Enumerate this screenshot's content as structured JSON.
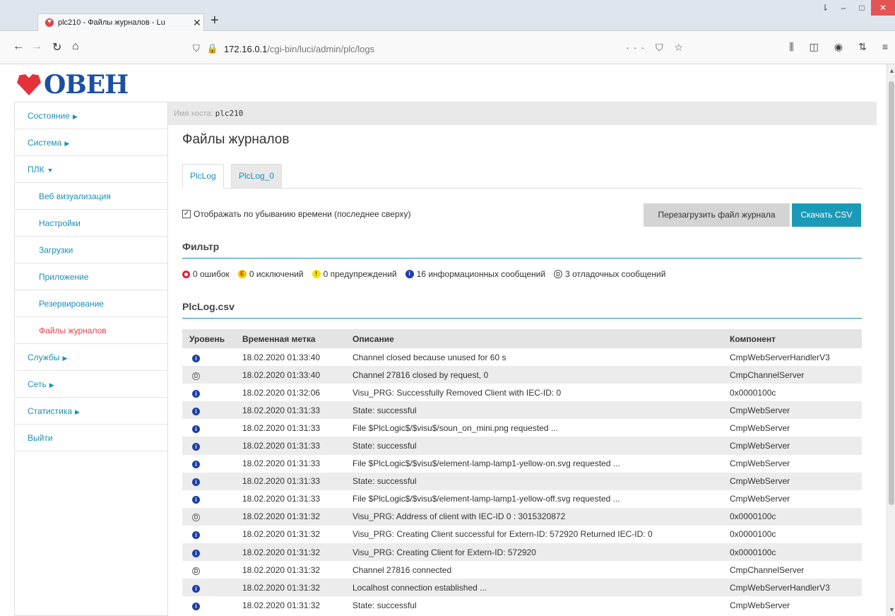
{
  "browser": {
    "tab_title": "plc210 - Файлы журналов - Lu",
    "new_tab": "+",
    "url_host": "172.16.0.1",
    "url_path": "/cgi-bin/luci/admin/plc/logs"
  },
  "brand": {
    "logo_text": "ОВЕН"
  },
  "sidebar": {
    "items": [
      {
        "label": "Состояние",
        "caret": "▶"
      },
      {
        "label": "Система",
        "caret": "▶"
      },
      {
        "label": "ПЛК",
        "caret": "▼"
      },
      {
        "label": "Веб визуализация"
      },
      {
        "label": "Настройки"
      },
      {
        "label": "Загрузки"
      },
      {
        "label": "Приложение"
      },
      {
        "label": "Резервирование"
      },
      {
        "label": "Файлы журналов"
      },
      {
        "label": "Службы",
        "caret": "▶"
      },
      {
        "label": "Сеть",
        "caret": "▶"
      },
      {
        "label": "Статистика",
        "caret": "▶"
      },
      {
        "label": "Выйти"
      }
    ]
  },
  "hostbar": {
    "label": "Имя хоста:",
    "value": "plc210"
  },
  "main": {
    "title": "Файлы журналов",
    "tabs": [
      "PlcLog",
      "PlcLog_0"
    ],
    "checkbox_label": "Отображать по убыванию времени (последнее сверху)",
    "reload_button": "Перезагрузить файл журнала",
    "csv_button": "Скачать CSV",
    "filter_heading": "Фильтр",
    "filters": {
      "errors": "0 ошибок",
      "exceptions": "0 исключений",
      "warnings": "0 предупреждений",
      "info": "16 информационных сообщений",
      "debug": "3 отладочных сообщений"
    },
    "csv_heading": "PlcLog.csv"
  },
  "table": {
    "headers": [
      "Уровень",
      "Временная метка",
      "Описание",
      "Компонент"
    ],
    "rows": [
      {
        "level": "info",
        "time": "18.02.2020 01:33:40",
        "desc": "Channel closed because unused for 60 s",
        "comp": "CmpWebServerHandlerV3"
      },
      {
        "level": "debug",
        "time": "18.02.2020 01:33:40",
        "desc": "Channel 27816 closed by request, 0",
        "comp": "CmpChannelServer"
      },
      {
        "level": "info",
        "time": "18.02.2020 01:32:06",
        "desc": "Visu_PRG: Successfully Removed Client with IEC-ID: 0",
        "comp": "0x0000100c"
      },
      {
        "level": "info",
        "time": "18.02.2020 01:31:33",
        "desc": "State: successful",
        "comp": "CmpWebServer"
      },
      {
        "level": "info",
        "time": "18.02.2020 01:31:33",
        "desc": "File $PlcLogic$/$visu$/soun_on_mini.png requested ...",
        "comp": "CmpWebServer"
      },
      {
        "level": "info",
        "time": "18.02.2020 01:31:33",
        "desc": "State: successful",
        "comp": "CmpWebServer"
      },
      {
        "level": "info",
        "time": "18.02.2020 01:31:33",
        "desc": "File $PlcLogic$/$visu$/element-lamp-lamp1-yellow-on.svg requested ...",
        "comp": "CmpWebServer"
      },
      {
        "level": "info",
        "time": "18.02.2020 01:31:33",
        "desc": "State: successful",
        "comp": "CmpWebServer"
      },
      {
        "level": "info",
        "time": "18.02.2020 01:31:33",
        "desc": "File $PlcLogic$/$visu$/element-lamp-lamp1-yellow-off.svg requested ...",
        "comp": "CmpWebServer"
      },
      {
        "level": "debug",
        "time": "18.02.2020 01:31:32",
        "desc": "Visu_PRG: Address of client with IEC-ID 0 : 3015320872",
        "comp": "0x0000100c"
      },
      {
        "level": "info",
        "time": "18.02.2020 01:31:32",
        "desc": "Visu_PRG: Creating Client successful for Extern-ID: 572920 Returned IEC-ID: 0",
        "comp": "0x0000100c"
      },
      {
        "level": "info",
        "time": "18.02.2020 01:31:32",
        "desc": "Visu_PRG: Creating Client for Extern-ID: 572920",
        "comp": "0x0000100c"
      },
      {
        "level": "debug",
        "time": "18.02.2020 01:31:32",
        "desc": "Channel 27816 connected",
        "comp": "CmpChannelServer"
      },
      {
        "level": "info",
        "time": "18.02.2020 01:31:32",
        "desc": "Localhost connection established ...",
        "comp": "CmpWebServerHandlerV3"
      },
      {
        "level": "info",
        "time": "18.02.2020 01:31:32",
        "desc": "State: successful",
        "comp": "CmpWebServer"
      }
    ]
  },
  "colors": {
    "accent": "#1a9ab7",
    "active_link": "#e04050",
    "logo_blue": "#1c4fa3",
    "logo_red": "#e3323b"
  }
}
